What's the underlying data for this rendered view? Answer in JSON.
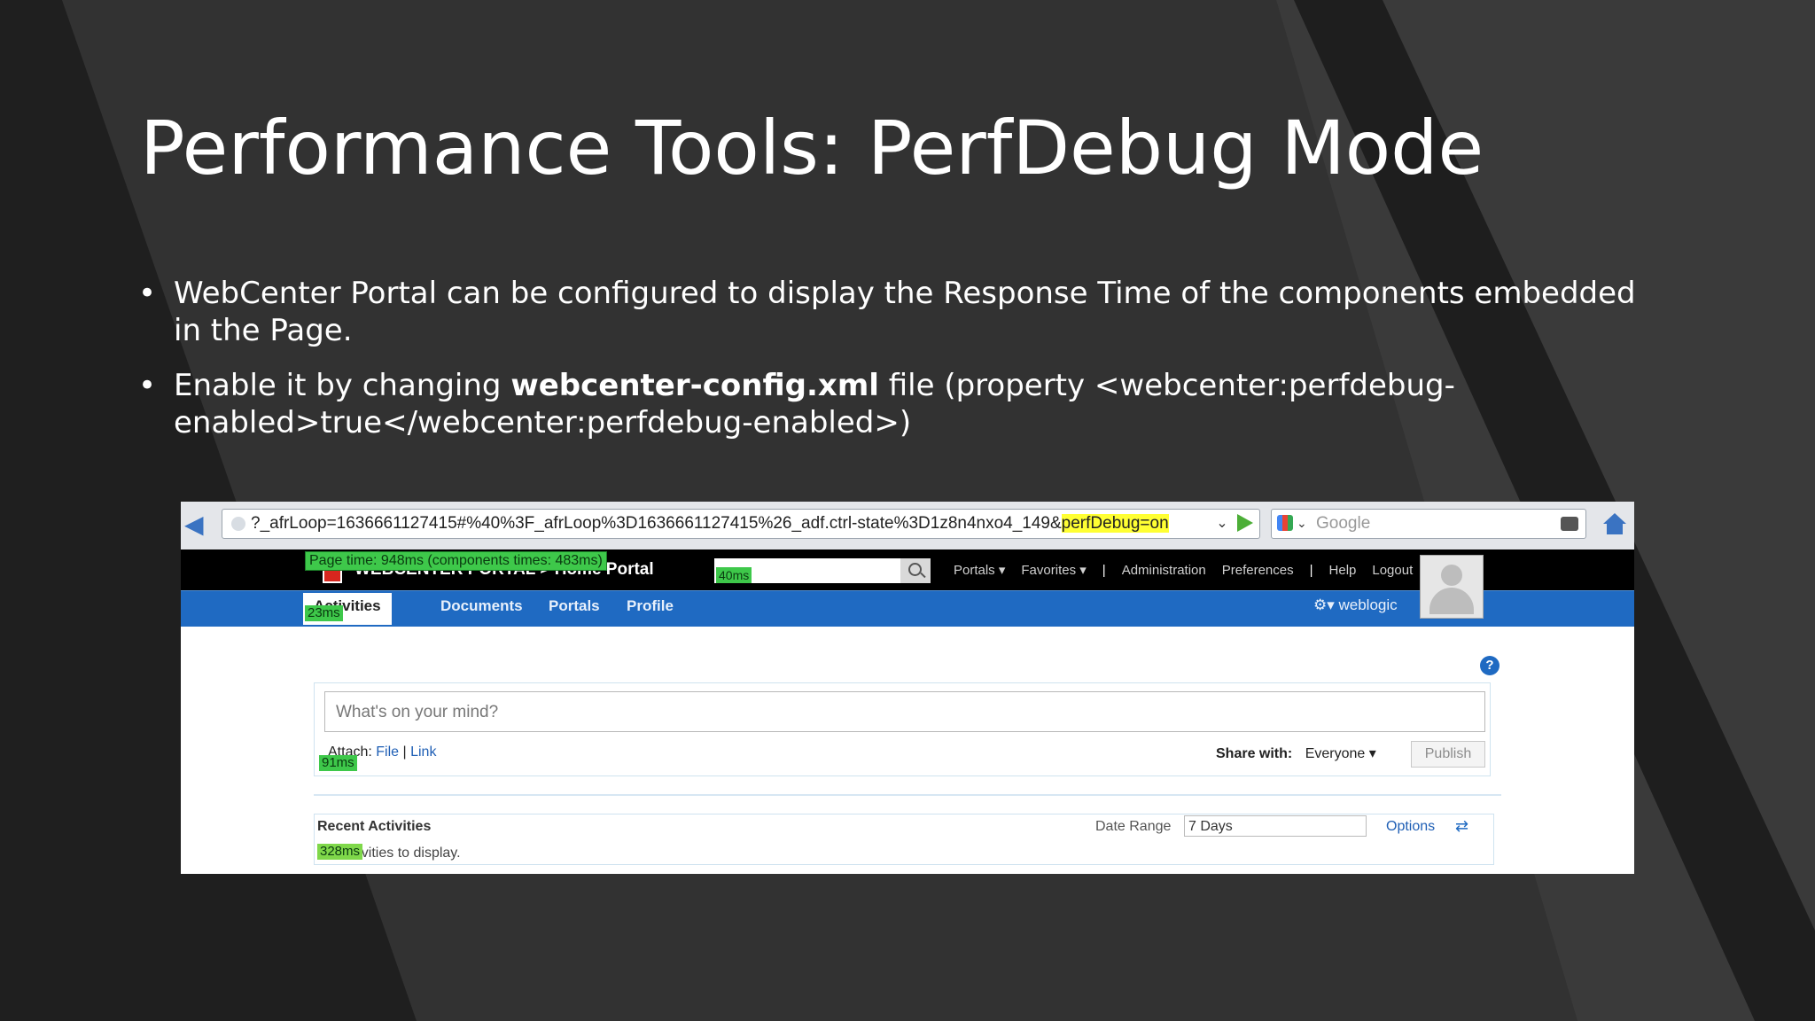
{
  "slide": {
    "title": "Performance Tools: PerfDebug Mode",
    "bullets": [
      {
        "text": "WebCenter Portal can be configured to display the Response Time of the components embedded in the Page."
      },
      {
        "pre": "Enable it by changing ",
        "bold": "webcenter-config.xml",
        "post": " file (property <webcenter:perfdebug-enabled>true</webcenter:perfdebug-enabled>)"
      }
    ],
    "bullet_char": "•"
  },
  "browser": {
    "url_main": "?_afrLoop=1636661127415#%40%3F_afrLoop%3D1636661127415%26_adf.ctrl-state%3D1z8n4nxo4_149&",
    "url_highlight": "perfDebug=on",
    "search_placeholder": "Google",
    "icons": [
      "back-arrow-icon",
      "go-arrow-icon",
      "google-icon",
      "binoculars-icon",
      "home-icon"
    ]
  },
  "portal": {
    "page_time": "Page time: 948ms (components times: 483ms)",
    "name": "WEBCENTER PORTAL > Home Portal",
    "search_time": "40ms",
    "nav": [
      "Portals ▾",
      "Favorites ▾",
      "|",
      "Administration",
      "Preferences",
      "|",
      "Help",
      "Logout"
    ],
    "tabs": [
      "Activities",
      "Documents",
      "Portals",
      "Profile"
    ],
    "tabs_time": "23ms",
    "user": "⚙▾  weblogic"
  },
  "activity": {
    "placeholder": "What's on your mind?",
    "attach_label": "Attach:",
    "attach_file": "File",
    "attach_link": "Link",
    "publisher_time": "91ms",
    "share_label": "Share with:",
    "share_value": "Everyone ▾",
    "publish": "Publish",
    "recent_title": "Recent Activities",
    "recent_time": "328ms",
    "recent_empty": "No activities to display.",
    "date_range_label": "Date Range",
    "date_range_value": "7 Days",
    "options": "Options"
  },
  "colors": {
    "accent_blue": "#1f6ac2",
    "perf_badge_green": "#3ec84a",
    "url_highlight": "#ffff33"
  }
}
